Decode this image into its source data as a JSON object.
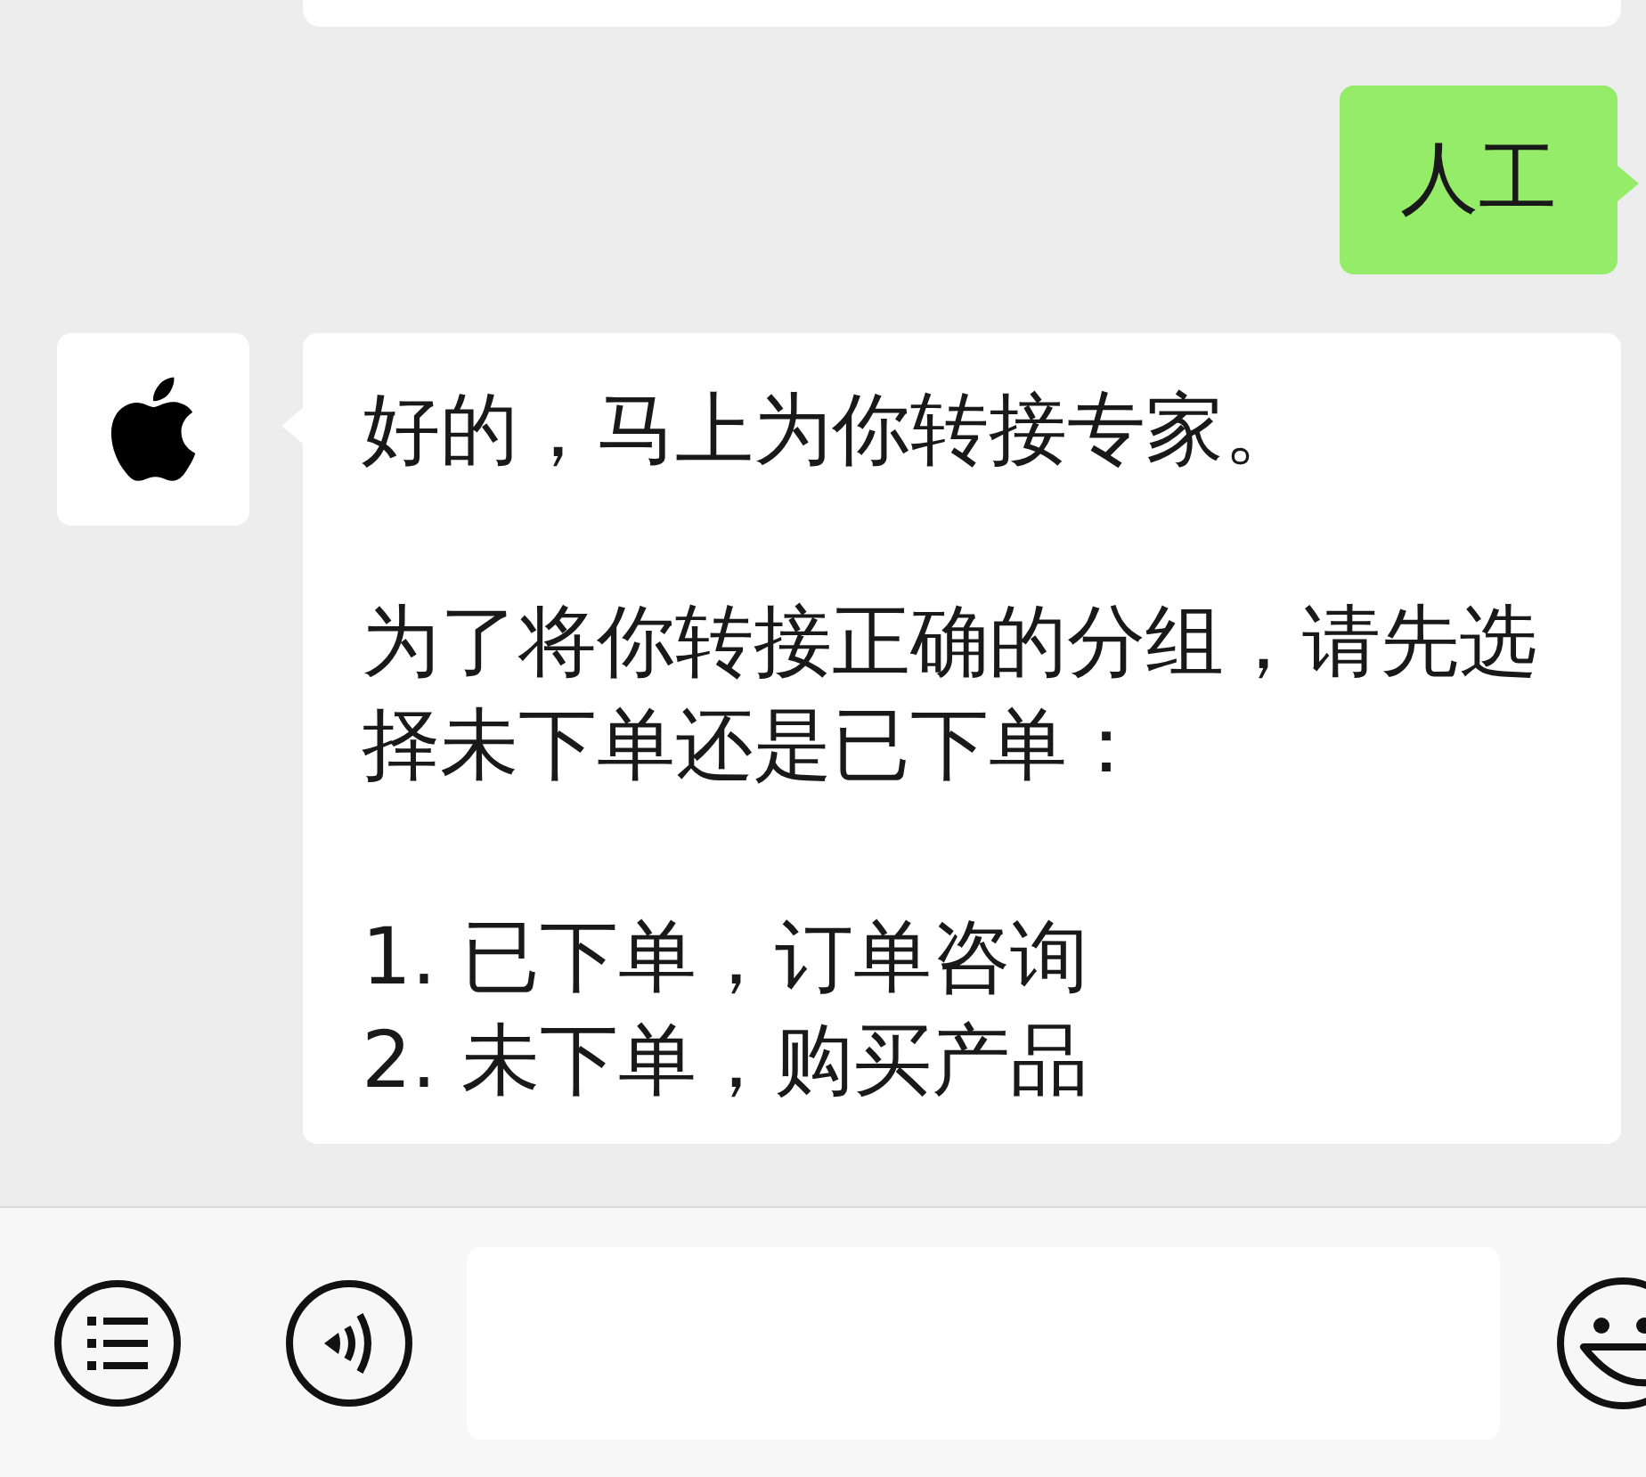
{
  "messages": [
    {
      "outgoing": false,
      "kind": "cut_off"
    },
    {
      "outgoing": true,
      "kind": "text",
      "paragraphs": [
        [
          "人工"
        ]
      ]
    },
    {
      "outgoing": false,
      "kind": "text",
      "paragraphs": [
        [
          "好的，马上为你转接专家。"
        ],
        [
          "为了将你转接正确的分组，请先选择未下单还是已下单："
        ],
        [
          "1. 已下单，订单咨询",
          "2. 未下单，购买产品"
        ]
      ]
    }
  ]
}
